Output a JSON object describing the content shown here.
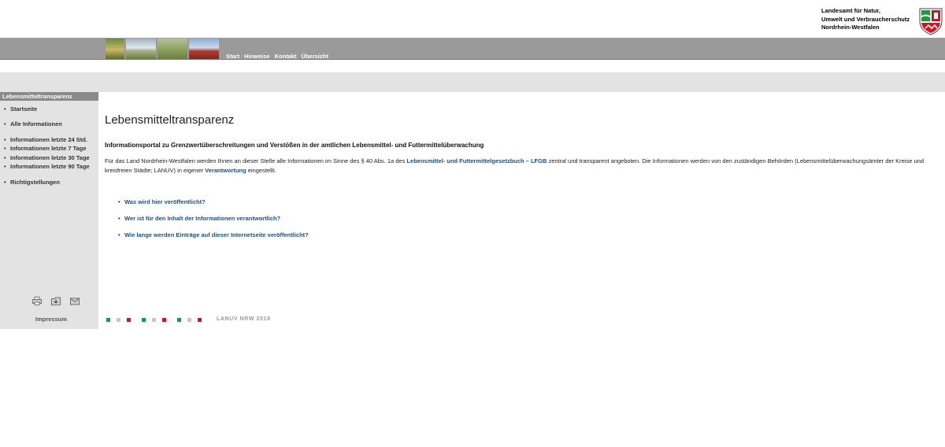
{
  "header": {
    "org_lines": [
      "Landesamt für Natur,",
      "Umwelt und Verbraucherschutz",
      "Nordrhein-Westfalen"
    ],
    "nav": [
      "Start",
      "Hinweise",
      "Kontakt",
      "Übersicht"
    ]
  },
  "sidebar": {
    "heading": "Lebensmitteltransparenz",
    "items": [
      {
        "bullet": "•",
        "label": "Startseite"
      },
      {
        "bullet": "•",
        "label": "Alle Informationen"
      },
      {
        "bullet": "•",
        "label": "Informationen letzte 24 Std."
      },
      {
        "bullet": "•",
        "label": "Informationen letzte 7 Tage"
      },
      {
        "bullet": "•",
        "label": "Informationen letzte 30 Tage"
      },
      {
        "bullet": "•",
        "label": "Informationen letzte 90 Tage"
      },
      {
        "bullet": "•",
        "label": "Richtigstellungen"
      }
    ],
    "icons": [
      "print-icon",
      "download-icon",
      "mail-icon"
    ],
    "impressum": "Impressum"
  },
  "main": {
    "title": "Lebensmitteltransparenz",
    "subtitle": "Informationsportal zu Grenzwertüberschreitungen und Verstößen in der amtlichen Lebensmittel- und Futtermittelüberwachung",
    "intro": {
      "part1": "Für das Land Nordrhein-Westfalen werden Ihnen an dieser Stelle alle Informationen im Sinne des § 40 Abs. 1a des ",
      "link1": "Lebensmittel- und Futtermittelgesetzbuch – LFGB",
      "part2": " zentral und transparent angeboten. Die Informationen werden von den zuständigen Behörden (Lebensmittelüberwachungsämter der Kreise und kreisfreien Städte; LANUV) in eigener ",
      "link2": "Verantwortung",
      "part3": " eingestellt."
    },
    "faq": [
      "Was wird hier veröffentlicht?",
      "Wer ist für den Inhalt der Informationen verantwortlich?",
      "Wie lange werden Einträge auf dieser Internetseite veröffentlicht?"
    ],
    "footer": "LANUV NRW 2018"
  },
  "colors": {
    "nav_band": "#9a9a9a",
    "sidebar_bg": "#e3e3e3",
    "link": "#1d4f86",
    "square_green": "#1f9a3a",
    "square_grey": "#c8c8c8",
    "square_red": "#d4141f"
  }
}
